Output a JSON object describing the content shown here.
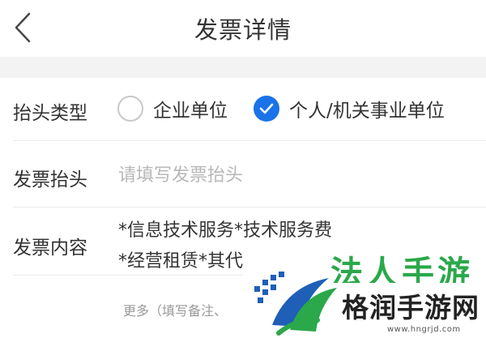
{
  "header": {
    "title": "发票详情",
    "back_icon": "chevron-left-icon"
  },
  "form": {
    "type_row": {
      "label": "抬头类型",
      "options": [
        {
          "label": "企业单位",
          "selected": false
        },
        {
          "label": "个人/机关事业单位",
          "selected": true
        }
      ]
    },
    "title_row": {
      "label": "发票抬头",
      "value": "",
      "placeholder": "请填写发票抬头"
    },
    "content_row": {
      "label": "发票内容",
      "lines": [
        "*信息技术服务*技术服务费",
        "*经营租赁*其代"
      ]
    },
    "more_row": {
      "text": "更多（填写备注、"
    }
  },
  "watermark": {
    "top_text": "法人手游",
    "main_text": "格润手游网",
    "url": "www.hngrjd.com"
  },
  "colors": {
    "accent": "#1a73e8",
    "background_band": "#f3f3f3",
    "placeholder": "#b8b8b8",
    "watermark_green": "#2aa84a",
    "watermark_blue": "#1f5fb8"
  }
}
